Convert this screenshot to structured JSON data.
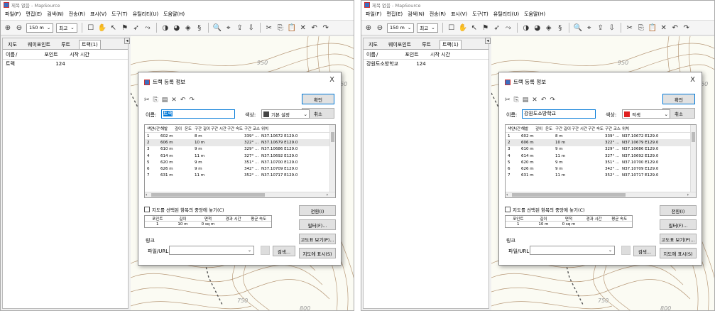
{
  "window": {
    "title": "제목 없음 - MapSource"
  },
  "menu": [
    "파일(F)",
    "편집(E)",
    "검색(N)",
    "전송(R)",
    "표시(V)",
    "도구(T)",
    "유틸리티(U)",
    "도움말(H)"
  ],
  "toolbar": {
    "zoom_value": "150 m",
    "zoom_mode": "최고",
    "dropdown_glyph": "⌄"
  },
  "panel": {
    "tabs": [
      "지도",
      "웨이포인트",
      "루트",
      "트랙(1)"
    ],
    "columns": [
      "이름",
      "/",
      "포인트",
      "시작 시간"
    ],
    "rows": [
      {
        "name_left": "트랙",
        "name_right": "강원도소방학교",
        "points": "124"
      }
    ]
  },
  "map": {
    "contour_labels": [
      "950",
      "850",
      "750",
      "800"
    ]
  },
  "dialog": {
    "title": "트랙 등록 정보",
    "close": "X",
    "ok_label": "확인",
    "cancel_label": "취소",
    "name_label": "이름:",
    "name_value_left": "트랙",
    "name_value_right": "강원도소방학교",
    "color_label": "색상:",
    "color_value_left": "기본 설정",
    "color_value_right": "적색",
    "color_left_hex": "#444444",
    "color_right_hex": "#e02020",
    "grid_columns": [
      "색인",
      "시간",
      "해발",
      "깊이",
      "온도",
      "구간 길이",
      "구간 시간",
      "구간 속도",
      "구간 코스",
      "위치"
    ],
    "grid_rows": [
      {
        "idx": "1",
        "alt": "602 m",
        "leg": "8 m",
        "course": "339° ...",
        "pos": "N37.10672 E129.0"
      },
      {
        "idx": "2",
        "alt": "606 m",
        "leg": "10 m",
        "course": "322° ...",
        "pos": "N37.10679 E129.0"
      },
      {
        "idx": "3",
        "alt": "610 m",
        "leg": "9 m",
        "course": "329° ...",
        "pos": "N37.10686 E129.0"
      },
      {
        "idx": "4",
        "alt": "614 m",
        "leg": "11 m",
        "course": "327° ...",
        "pos": "N37.10692 E129.0"
      },
      {
        "idx": "5",
        "alt": "620 m",
        "leg": "9 m",
        "course": "351° ...",
        "pos": "N37.10700 E129.0"
      },
      {
        "idx": "6",
        "alt": "626 m",
        "leg": "9 m",
        "course": "342° ...",
        "pos": "N37.10709 E129.0"
      },
      {
        "idx": "7",
        "alt": "631 m",
        "leg": "11 m",
        "course": "352° ...",
        "pos": "N37.10717 E129.0"
      }
    ],
    "center_checkbox": "지도를 선택된 항목의 중앙에 놓기(C)",
    "stats_columns": [
      "포인트",
      "길이",
      "면적",
      "경과 시간",
      "평균 속도"
    ],
    "stats_values": [
      "1",
      "10 m",
      "0 sq m",
      "",
      ""
    ],
    "link_label": "링크",
    "file_url_label": "파일/URL:",
    "search_label": "검색...",
    "buttons": [
      "전환(I)",
      "필터(F)...",
      "고도표 보기(P)...",
      "지도에 표시(S)"
    ]
  }
}
